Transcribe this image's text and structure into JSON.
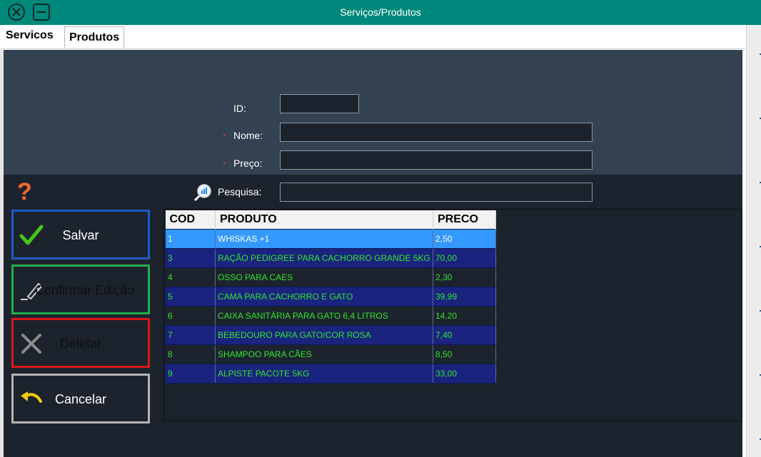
{
  "window": {
    "title": "Serviços/Produtos"
  },
  "tabs": [
    {
      "label": "Servicos"
    },
    {
      "label": "Produtos"
    }
  ],
  "form": {
    "id": {
      "label": "ID:",
      "value": ""
    },
    "nome": {
      "label": "Nome:",
      "required_mark": "*",
      "value": ""
    },
    "preco": {
      "label": "Preço:",
      "required_mark": "*",
      "value": ""
    },
    "pesquisa": {
      "label": "Pesquisa:",
      "value": ""
    },
    "help": "?"
  },
  "buttons": {
    "salvar": "Salvar",
    "confirmar": "Confirmar Edição",
    "deletar": "Deletar",
    "cancelar": "Cancelar"
  },
  "grid": {
    "columns": [
      "COD",
      "PRODUTO",
      "PRECO"
    ],
    "rows": [
      {
        "cod": "1",
        "produto": "WHISKAS +1",
        "preco": "2,50",
        "selected": true
      },
      {
        "cod": "3",
        "produto": "RAÇÃO PEDIGREE PARA CACHORRO GRANDE 5KG",
        "preco": "70,00"
      },
      {
        "cod": "4",
        "produto": "OSSO PARA CAES",
        "preco": "2,30"
      },
      {
        "cod": "5",
        "produto": "CAMA PARA CACHORRO E GATO",
        "preco": "39,99"
      },
      {
        "cod": "6",
        "produto": "CAIXA SANITÁRIA PARA GATO 6,4 LITROS",
        "preco": "14,20"
      },
      {
        "cod": "7",
        "produto": "BEBEDOURO PARA GATO/COR ROSA",
        "preco": "7,40"
      },
      {
        "cod": "8",
        "produto": "SHAMPOO PARA CÃES",
        "preco": "8,50"
      },
      {
        "cod": "9",
        "produto": "ALPISTE PACOTE 5KG",
        "preco": "33,00"
      }
    ]
  },
  "icons": {
    "close": "close-circle-icon",
    "minimize": "minimize-icon",
    "help": "question-mark-icon",
    "search": "magnifier-chart-icon",
    "save": "checkmark-icon",
    "edit": "pencil-icon",
    "delete": "x-icon",
    "cancel": "undo-arrow-icon"
  },
  "colors": {
    "titlebar": "#00897b",
    "panel_upper": "#334150",
    "panel_lower": "#1d232c",
    "row_even": "#1a237e",
    "row_selected": "#3399ff",
    "row_text": "#2ee62e",
    "salvar_border": "#1e5bc6",
    "confirmar_border": "#22b14c",
    "deletar_border": "#d7191c",
    "cancelar_border": "#b4b4b4"
  }
}
